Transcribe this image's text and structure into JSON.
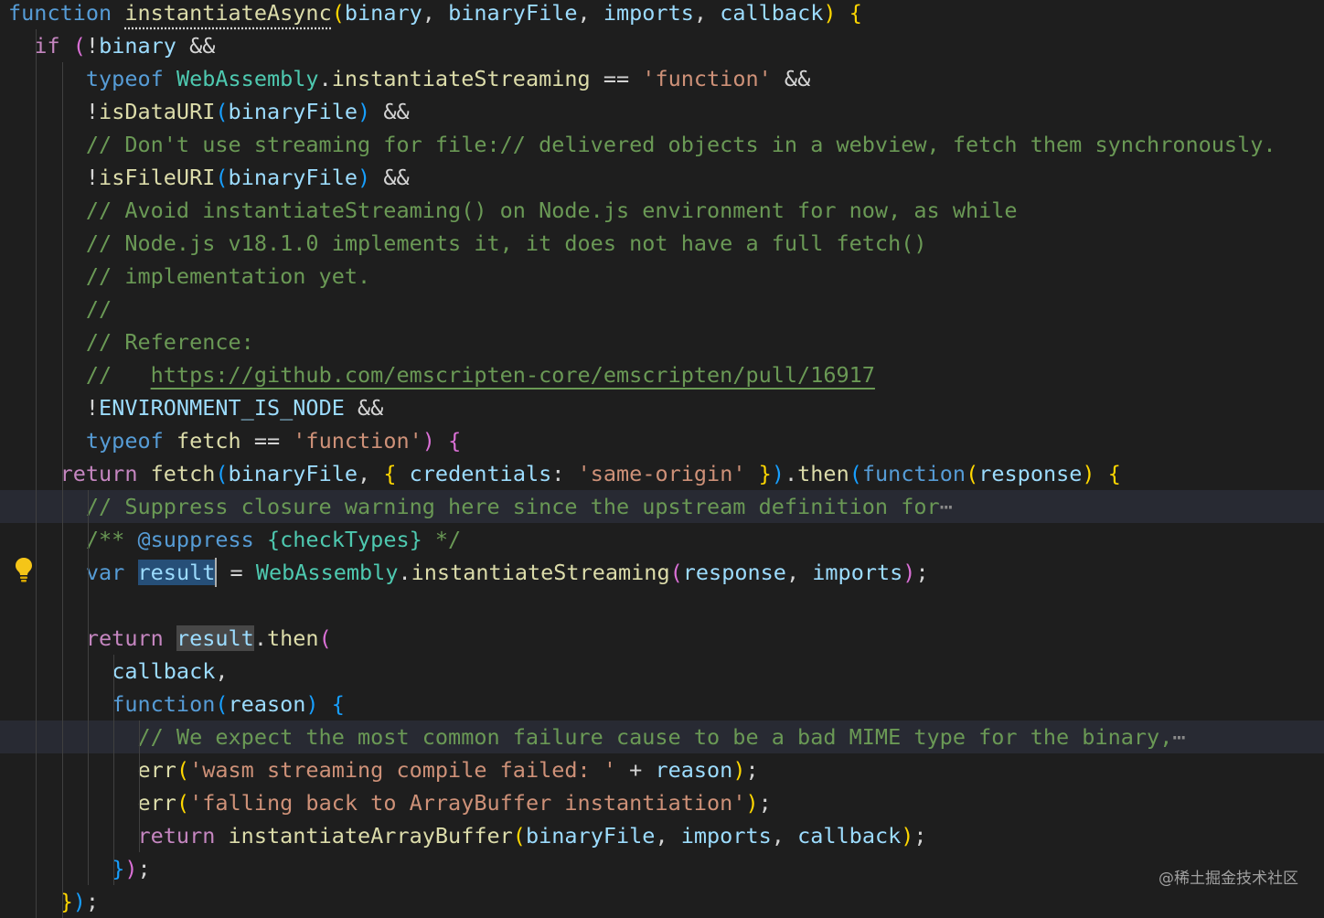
{
  "editor": {
    "language": "javascript",
    "theme_colors": {
      "background": "#1e1e1e",
      "keyword": "#569cd6",
      "control_keyword": "#c586c0",
      "function": "#dcdcaa",
      "variable": "#9cdcfe",
      "type": "#4ec9b0",
      "string": "#ce9178",
      "comment": "#6a9955",
      "selection": "#264f78",
      "line_highlight": "#282a33"
    },
    "lines": [
      {
        "tokens": [
          {
            "c": "k",
            "t": "function"
          },
          {
            "c": "p",
            "t": " "
          },
          {
            "c": "f squig",
            "t": "instantiateAsync"
          },
          {
            "c": "b1",
            "t": "("
          },
          {
            "c": "v",
            "t": "binary"
          },
          {
            "c": "p",
            "t": ", "
          },
          {
            "c": "v",
            "t": "binaryFile"
          },
          {
            "c": "p",
            "t": ", "
          },
          {
            "c": "v",
            "t": "imports"
          },
          {
            "c": "p",
            "t": ", "
          },
          {
            "c": "v",
            "t": "callback"
          },
          {
            "c": "b1",
            "t": ")"
          },
          {
            "c": "p",
            "t": " "
          },
          {
            "c": "b1",
            "t": "{"
          }
        ]
      },
      {
        "tokens": [
          {
            "c": "p",
            "t": "  "
          },
          {
            "c": "kc",
            "t": "if"
          },
          {
            "c": "p",
            "t": " "
          },
          {
            "c": "b2",
            "t": "("
          },
          {
            "c": "p",
            "t": "!"
          },
          {
            "c": "v",
            "t": "binary"
          },
          {
            "c": "p",
            "t": " &&"
          }
        ]
      },
      {
        "tokens": [
          {
            "c": "p",
            "t": "      "
          },
          {
            "c": "k",
            "t": "typeof"
          },
          {
            "c": "p",
            "t": " "
          },
          {
            "c": "t",
            "t": "WebAssembly"
          },
          {
            "c": "p",
            "t": "."
          },
          {
            "c": "f",
            "t": "instantiateStreaming"
          },
          {
            "c": "p",
            "t": " == "
          },
          {
            "c": "s",
            "t": "'function'"
          },
          {
            "c": "p",
            "t": " &&"
          }
        ]
      },
      {
        "tokens": [
          {
            "c": "p",
            "t": "      !"
          },
          {
            "c": "f",
            "t": "isDataURI"
          },
          {
            "c": "b3",
            "t": "("
          },
          {
            "c": "v",
            "t": "binaryFile"
          },
          {
            "c": "b3",
            "t": ")"
          },
          {
            "c": "p",
            "t": " &&"
          }
        ]
      },
      {
        "tokens": [
          {
            "c": "p",
            "t": "      "
          },
          {
            "c": "c",
            "t": "// Don't use streaming for file:// delivered objects in a webview, fetch them synchronously."
          }
        ]
      },
      {
        "tokens": [
          {
            "c": "p",
            "t": "      !"
          },
          {
            "c": "f",
            "t": "isFileURI"
          },
          {
            "c": "b3",
            "t": "("
          },
          {
            "c": "v",
            "t": "binaryFile"
          },
          {
            "c": "b3",
            "t": ")"
          },
          {
            "c": "p",
            "t": " &&"
          }
        ]
      },
      {
        "tokens": [
          {
            "c": "p",
            "t": "      "
          },
          {
            "c": "c",
            "t": "// Avoid instantiateStreaming() on Node.js environment for now, as while"
          }
        ]
      },
      {
        "tokens": [
          {
            "c": "p",
            "t": "      "
          },
          {
            "c": "c",
            "t": "// Node.js v18.1.0 implements it, it does not have a full fetch()"
          }
        ]
      },
      {
        "tokens": [
          {
            "c": "p",
            "t": "      "
          },
          {
            "c": "c",
            "t": "// implementation yet."
          }
        ]
      },
      {
        "tokens": [
          {
            "c": "p",
            "t": "      "
          },
          {
            "c": "c",
            "t": "//"
          }
        ]
      },
      {
        "tokens": [
          {
            "c": "p",
            "t": "      "
          },
          {
            "c": "c",
            "t": "// Reference:"
          }
        ]
      },
      {
        "tokens": [
          {
            "c": "p",
            "t": "      "
          },
          {
            "c": "c",
            "t": "//   "
          },
          {
            "c": "c link",
            "t": "https://github.com/emscripten-core/emscripten/pull/16917"
          }
        ]
      },
      {
        "tokens": [
          {
            "c": "p",
            "t": "      !"
          },
          {
            "c": "v",
            "t": "ENVIRONMENT_IS_NODE"
          },
          {
            "c": "p",
            "t": " &&"
          }
        ]
      },
      {
        "tokens": [
          {
            "c": "p",
            "t": "      "
          },
          {
            "c": "k",
            "t": "typeof"
          },
          {
            "c": "p",
            "t": " "
          },
          {
            "c": "f",
            "t": "fetch"
          },
          {
            "c": "p",
            "t": " == "
          },
          {
            "c": "s",
            "t": "'function'"
          },
          {
            "c": "b2",
            "t": ")"
          },
          {
            "c": "p",
            "t": " "
          },
          {
            "c": "b2",
            "t": "{"
          }
        ]
      },
      {
        "tokens": [
          {
            "c": "p",
            "t": "    "
          },
          {
            "c": "kc",
            "t": "return"
          },
          {
            "c": "p",
            "t": " "
          },
          {
            "c": "f",
            "t": "fetch"
          },
          {
            "c": "b3",
            "t": "("
          },
          {
            "c": "v",
            "t": "binaryFile"
          },
          {
            "c": "p",
            "t": ", "
          },
          {
            "c": "b1",
            "t": "{"
          },
          {
            "c": "p",
            "t": " "
          },
          {
            "c": "v",
            "t": "credentials"
          },
          {
            "c": "p",
            "t": ": "
          },
          {
            "c": "s",
            "t": "'same-origin'"
          },
          {
            "c": "p",
            "t": " "
          },
          {
            "c": "b1",
            "t": "}"
          },
          {
            "c": "b3",
            "t": ")"
          },
          {
            "c": "p",
            "t": "."
          },
          {
            "c": "f",
            "t": "then"
          },
          {
            "c": "b3",
            "t": "("
          },
          {
            "c": "k",
            "t": "function"
          },
          {
            "c": "b1",
            "t": "("
          },
          {
            "c": "v",
            "t": "response"
          },
          {
            "c": "b1",
            "t": ")"
          },
          {
            "c": "p",
            "t": " "
          },
          {
            "c": "b1",
            "t": "{"
          }
        ]
      },
      {
        "highlight": true,
        "tokens": [
          {
            "c": "p",
            "t": "      "
          },
          {
            "c": "c",
            "t": "// Suppress closure warning here since the upstream definition for"
          },
          {
            "c": "ellipsis",
            "t": "⋯"
          }
        ]
      },
      {
        "tokens": [
          {
            "c": "p",
            "t": "      "
          },
          {
            "c": "c",
            "t": "/** "
          },
          {
            "c": "k",
            "t": "@suppress"
          },
          {
            "c": "p",
            "t": " "
          },
          {
            "c": "t",
            "t": "{checkTypes}"
          },
          {
            "c": "c",
            "t": " */"
          }
        ]
      },
      {
        "tokens": [
          {
            "c": "p",
            "t": "      "
          },
          {
            "c": "k",
            "t": "var"
          },
          {
            "c": "p",
            "t": " "
          },
          {
            "c": "v sel",
            "t": "result"
          },
          {
            "c": "cursor",
            "t": ""
          },
          {
            "c": "p",
            "t": " = "
          },
          {
            "c": "t",
            "t": "WebAssembly"
          },
          {
            "c": "p",
            "t": "."
          },
          {
            "c": "f",
            "t": "instantiateStreaming"
          },
          {
            "c": "b2",
            "t": "("
          },
          {
            "c": "v",
            "t": "response"
          },
          {
            "c": "p",
            "t": ", "
          },
          {
            "c": "v",
            "t": "imports"
          },
          {
            "c": "b2",
            "t": ")"
          },
          {
            "c": "p",
            "t": ";"
          }
        ]
      },
      {
        "tokens": []
      },
      {
        "tokens": [
          {
            "c": "p",
            "t": "      "
          },
          {
            "c": "kc",
            "t": "return"
          },
          {
            "c": "p",
            "t": " "
          },
          {
            "c": "v occ",
            "t": "result"
          },
          {
            "c": "p",
            "t": "."
          },
          {
            "c": "f",
            "t": "then"
          },
          {
            "c": "b2",
            "t": "("
          }
        ]
      },
      {
        "tokens": [
          {
            "c": "p",
            "t": "        "
          },
          {
            "c": "v",
            "t": "callback"
          },
          {
            "c": "p",
            "t": ","
          }
        ]
      },
      {
        "tokens": [
          {
            "c": "p",
            "t": "        "
          },
          {
            "c": "k",
            "t": "function"
          },
          {
            "c": "b3",
            "t": "("
          },
          {
            "c": "v",
            "t": "reason"
          },
          {
            "c": "b3",
            "t": ")"
          },
          {
            "c": "p",
            "t": " "
          },
          {
            "c": "b3",
            "t": "{"
          }
        ]
      },
      {
        "highlight": true,
        "tokens": [
          {
            "c": "p",
            "t": "          "
          },
          {
            "c": "c",
            "t": "// We expect the most common failure cause to be a bad MIME type for the binary,"
          },
          {
            "c": "ellipsis",
            "t": "⋯"
          }
        ]
      },
      {
        "tokens": [
          {
            "c": "p",
            "t": "          "
          },
          {
            "c": "f",
            "t": "err"
          },
          {
            "c": "b1",
            "t": "("
          },
          {
            "c": "s",
            "t": "'wasm streaming compile failed: '"
          },
          {
            "c": "p",
            "t": " + "
          },
          {
            "c": "v",
            "t": "reason"
          },
          {
            "c": "b1",
            "t": ")"
          },
          {
            "c": "p",
            "t": ";"
          }
        ]
      },
      {
        "tokens": [
          {
            "c": "p",
            "t": "          "
          },
          {
            "c": "f",
            "t": "err"
          },
          {
            "c": "b1",
            "t": "("
          },
          {
            "c": "s",
            "t": "'falling back to ArrayBuffer instantiation'"
          },
          {
            "c": "b1",
            "t": ")"
          },
          {
            "c": "p",
            "t": ";"
          }
        ]
      },
      {
        "tokens": [
          {
            "c": "p",
            "t": "          "
          },
          {
            "c": "kc",
            "t": "return"
          },
          {
            "c": "p",
            "t": " "
          },
          {
            "c": "f",
            "t": "instantiateArrayBuffer"
          },
          {
            "c": "b1",
            "t": "("
          },
          {
            "c": "v",
            "t": "binaryFile"
          },
          {
            "c": "p",
            "t": ", "
          },
          {
            "c": "v",
            "t": "imports"
          },
          {
            "c": "p",
            "t": ", "
          },
          {
            "c": "v",
            "t": "callback"
          },
          {
            "c": "b1",
            "t": ")"
          },
          {
            "c": "p",
            "t": ";"
          }
        ]
      },
      {
        "tokens": [
          {
            "c": "p",
            "t": "        "
          },
          {
            "c": "b3",
            "t": "}"
          },
          {
            "c": "b2",
            "t": ")"
          },
          {
            "c": "p",
            "t": ";"
          }
        ]
      },
      {
        "tokens": [
          {
            "c": "p",
            "t": "    "
          },
          {
            "c": "b1",
            "t": "}"
          },
          {
            "c": "b3",
            "t": ")"
          },
          {
            "c": "p",
            "t": ";"
          }
        ]
      }
    ]
  },
  "lightbulb": {
    "icon": "lightbulb-icon",
    "color": "#f5c518"
  },
  "watermark": {
    "text": "@稀土掘金技术社区"
  }
}
